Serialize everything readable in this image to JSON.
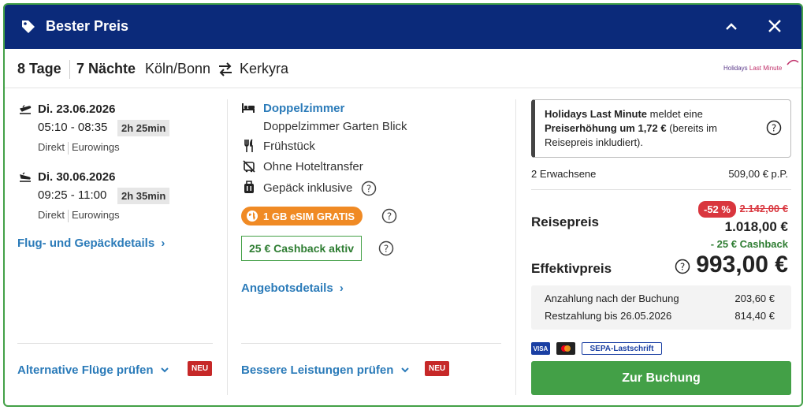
{
  "header": {
    "title": "Bester Preis"
  },
  "trip": {
    "days": "8 Tage",
    "nights": "7 Nächte",
    "from": "Köln/Bonn",
    "to": "Kerkyra",
    "operator_logo_a": "Holidays ",
    "operator_logo_b": "Last Minute"
  },
  "flights": {
    "outbound": {
      "date": "Di. 23.06.2026",
      "time": "05:10 - 08:35",
      "duration": "2h 25min",
      "type": "Direkt",
      "airline": "Eurowings"
    },
    "return": {
      "date": "Di. 30.06.2026",
      "time": "09:25 - 11:00",
      "duration": "2h 35min",
      "type": "Direkt",
      "airline": "Eurowings"
    },
    "details_link": "Flug- und Gepäckdetails",
    "alt_link": "Alternative Flüge prüfen",
    "new_badge": "NEU"
  },
  "hotel": {
    "room": "Doppelzimmer",
    "room_detail": "Doppelzimmer Garten Blick",
    "board": "Frühstück",
    "transfer": "Ohne Hoteltransfer",
    "luggage": "Gepäck inklusive",
    "esim": "1 GB eSIM GRATIS",
    "cashback": "25 € Cashback aktiv",
    "offer_link": "Angebotsdetails",
    "better_link": "Bessere Leistungen prüfen",
    "new_badge": "NEU"
  },
  "price": {
    "notice_provider": "Holidays Last Minute",
    "notice_text1": " meldet eine ",
    "notice_bold": "Preiserhöhung um 1,72 €",
    "notice_text2": " (bereits im Reisepreis inkludiert).",
    "travellers": "2 Erwachsene",
    "per_person": "509,00 € p.P.",
    "label_reisepreis": "Reisepreis",
    "discount": "-52 %",
    "old_price": "2.142,00 €",
    "reisepreis": "1.018,00 €",
    "cashback": "- 25 € Cashback",
    "label_effektiv": "Effektivpreis",
    "effektiv": "993,00 €",
    "deposit_label": "Anzahlung nach der Buchung",
    "deposit_value": "203,60 €",
    "rest_label": "Restzahlung bis 26.05.2026",
    "rest_value": "814,40 €",
    "pay_visa": "VISA",
    "pay_sepa": "SEPA-Lastschrift",
    "cta": "Zur Buchung"
  }
}
